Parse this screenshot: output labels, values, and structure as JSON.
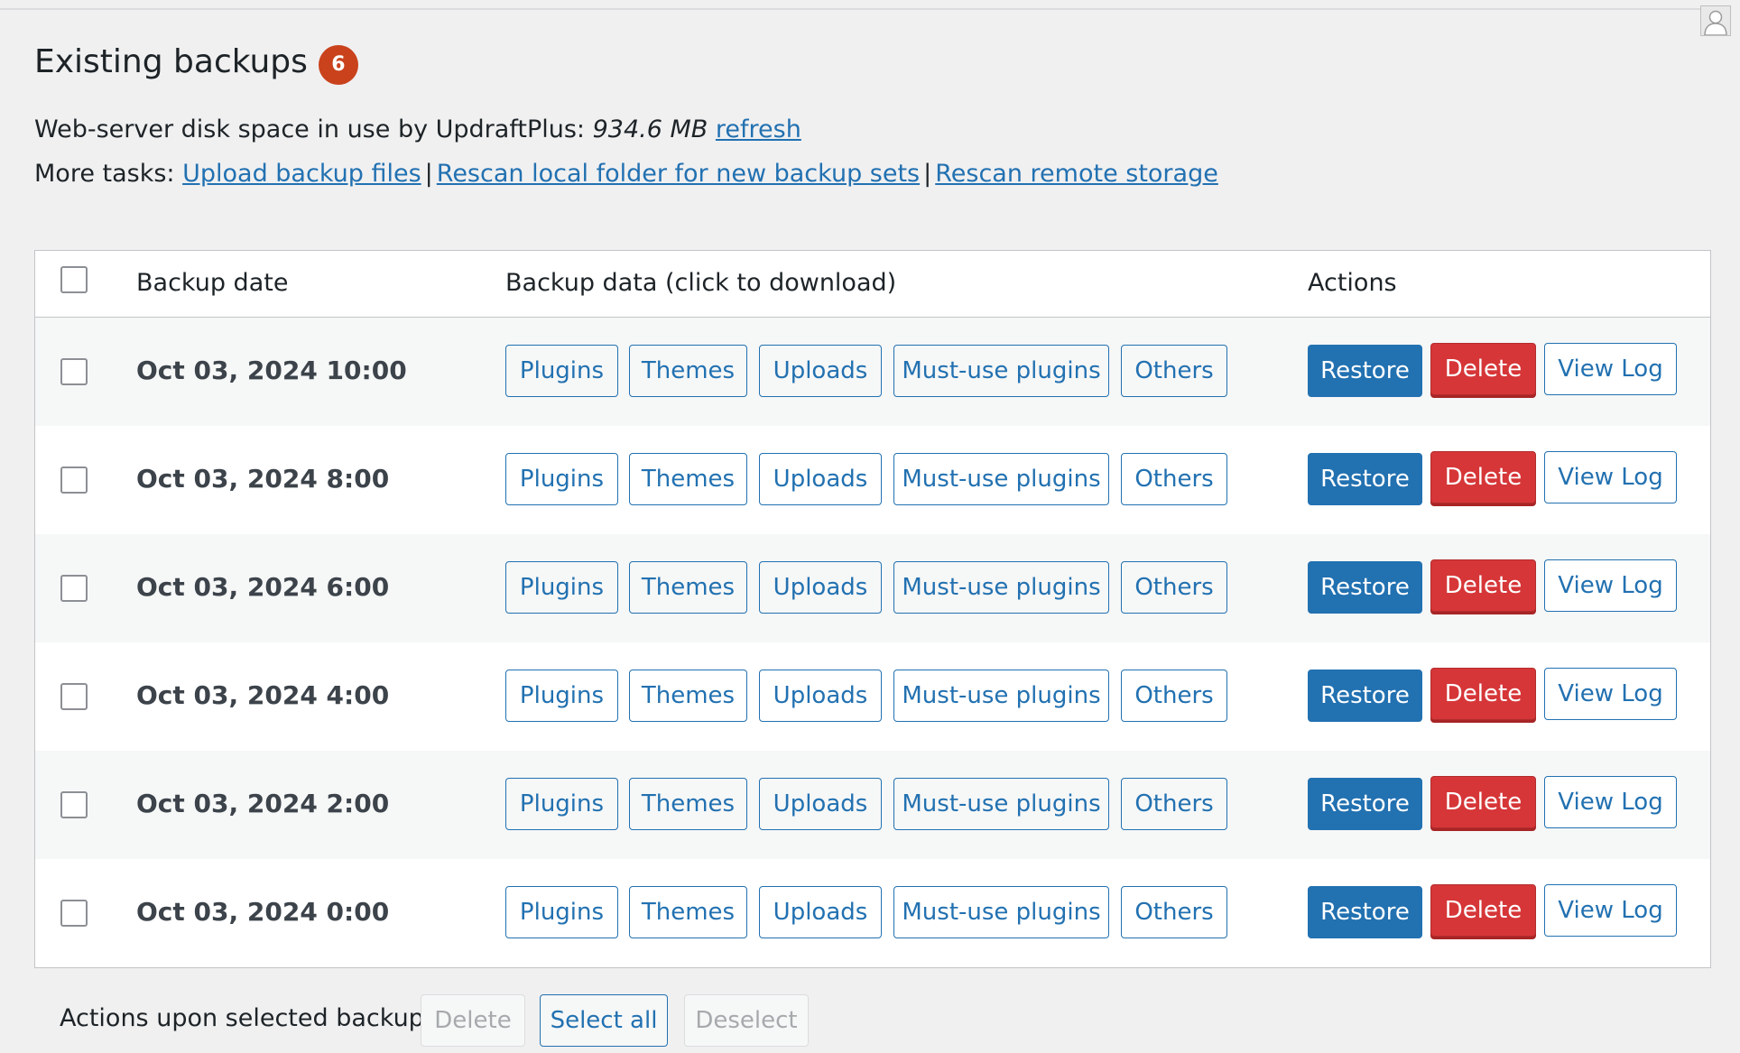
{
  "header": {
    "title": "Existing backups",
    "count": "6"
  },
  "disk": {
    "label": "Web-server disk space in use by UpdraftPlus:",
    "value": "934.6 MB",
    "refresh_label": "refresh"
  },
  "tasks": {
    "label": "More tasks:",
    "links": [
      "Upload backup files",
      "Rescan local folder for new backup sets",
      "Rescan remote storage"
    ],
    "separator": "|"
  },
  "table": {
    "columns": [
      "Backup date",
      "Backup data (click to download)",
      "Actions"
    ],
    "data_buttons": [
      "Plugins",
      "Themes",
      "Uploads",
      "Must-use plugins",
      "Others"
    ],
    "action_buttons": {
      "restore": "Restore",
      "delete": "Delete",
      "view_log": "View Log"
    },
    "rows": [
      {
        "date": "Oct 03, 2024 10:00"
      },
      {
        "date": "Oct 03, 2024 8:00"
      },
      {
        "date": "Oct 03, 2024 6:00"
      },
      {
        "date": "Oct 03, 2024 4:00"
      },
      {
        "date": "Oct 03, 2024 2:00"
      },
      {
        "date": "Oct 03, 2024 0:00"
      }
    ]
  },
  "footer": {
    "label": "Actions upon selected backups",
    "delete_label": "Delete",
    "select_all_label": "Select all",
    "deselect_label": "Deselect"
  },
  "colors": {
    "accent": "#2271b1",
    "danger": "#d63638",
    "badge": "#c9421c"
  },
  "icons": {
    "avatar": "user-avatar-icon"
  }
}
